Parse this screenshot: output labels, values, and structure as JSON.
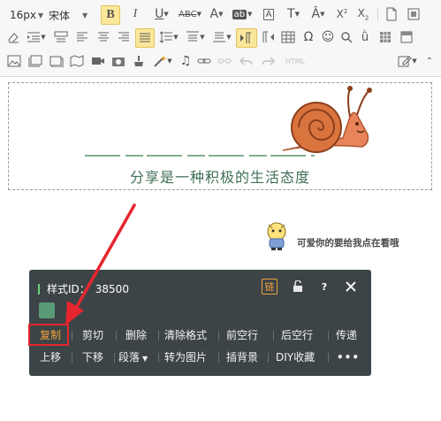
{
  "toolbar": {
    "font_size": "16px",
    "font_family": "宋体",
    "html_label": "HTML"
  },
  "content": {
    "slogan": "分享是一种积极的生活态度",
    "sticker_caption": "可爱你的要给我点在看哦"
  },
  "panel": {
    "title_label": "样式ID：",
    "style_id": "38500",
    "link_icon_label": "链",
    "help_label": "?",
    "actions_row1": [
      "复制",
      "剪切",
      "删除",
      "清除格式",
      "前空行",
      "后空行",
      "传递"
    ],
    "actions_row2": [
      "上移",
      "下移",
      "段落",
      "转为图片",
      "插背景",
      "DIY收藏",
      "•••"
    ],
    "colors": {
      "panel_bg": "#3d4448",
      "highlight": "#f0a23b",
      "swatch": "#5a9b77",
      "callout": "#e5262f"
    }
  }
}
